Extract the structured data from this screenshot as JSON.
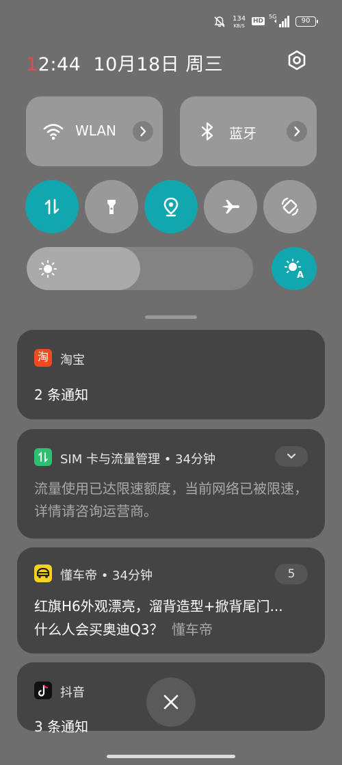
{
  "status_bar": {
    "net_speed": "134",
    "net_unit": "KB/S",
    "hd_badge": "HD",
    "network_type": "5G",
    "battery": "90",
    "icons": [
      "mute-icon",
      "hd-icon",
      "signal-icon",
      "battery-icon"
    ]
  },
  "header": {
    "time_first_digit": "1",
    "time_rest": "2:44",
    "date": "10月18日 周三",
    "settings_icon": "gear-icon"
  },
  "tiles": [
    {
      "label": "WLAN",
      "icon": "wifi-icon"
    },
    {
      "label": "蓝牙",
      "icon": "bluetooth-icon"
    }
  ],
  "toggles": [
    {
      "icon": "mobile-data-icon",
      "active": true
    },
    {
      "icon": "flashlight-icon",
      "active": false
    },
    {
      "icon": "location-icon",
      "active": true
    },
    {
      "icon": "airplane-icon",
      "active": false
    },
    {
      "icon": "auto-rotate-icon",
      "active": false
    }
  ],
  "brightness": {
    "level": 0.5,
    "auto": true
  },
  "notifications": [
    {
      "app": "淘宝",
      "title": "2 条通知"
    },
    {
      "app": "SIM 卡与流量管理 • 34分钟",
      "body": "流量使用已达限速额度，当前网络已被限速，详情请咨询运营商。"
    },
    {
      "app": "懂车帝 • 34分钟",
      "count": "5",
      "title": "红旗H6外观漂亮，溜背造型+掀背尾门...",
      "subtitle": "什么人会买奥迪Q3？",
      "subtitle_source": "懂车帝"
    },
    {
      "app": "抖音",
      "title": "3 条通知"
    }
  ],
  "colors": {
    "accent": "#12a6ae",
    "clock_red": "#e44b4b"
  }
}
